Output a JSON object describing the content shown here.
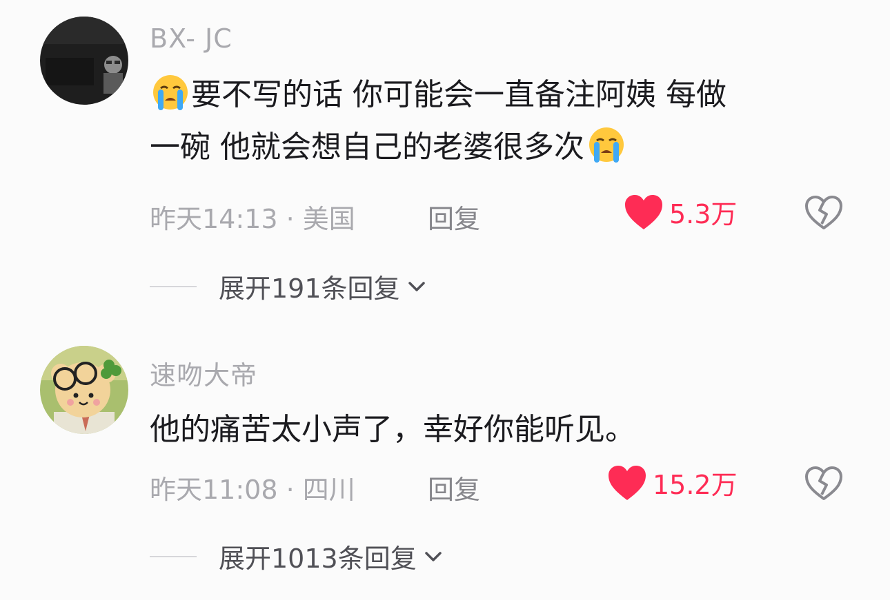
{
  "comments": [
    {
      "username": "BX- JC",
      "text_line1": "要不写的话 你可能会一直备注阿姨 每做",
      "text_line2": "一碗 他就会想自己的老婆很多次",
      "meta": "昨天14:13 · 美国",
      "reply_label": "回复",
      "like_count": "5.3万",
      "expand_label": "展开191条回复"
    },
    {
      "username": "速吻大帝",
      "text_line1": "他的痛苦太小声了，幸好你能听见。",
      "meta": "昨天11:08 · 四川",
      "reply_label": "回复",
      "like_count": "15.2万",
      "expand_label": "展开1013条回复"
    }
  ],
  "colors": {
    "like": "#fe2c55",
    "secondary_text": "#a9a9ae",
    "primary_text": "#1b1b1f"
  },
  "icons": [
    "crying-emoji-icon",
    "heart-icon",
    "broken-heart-icon",
    "chevron-down-icon"
  ]
}
